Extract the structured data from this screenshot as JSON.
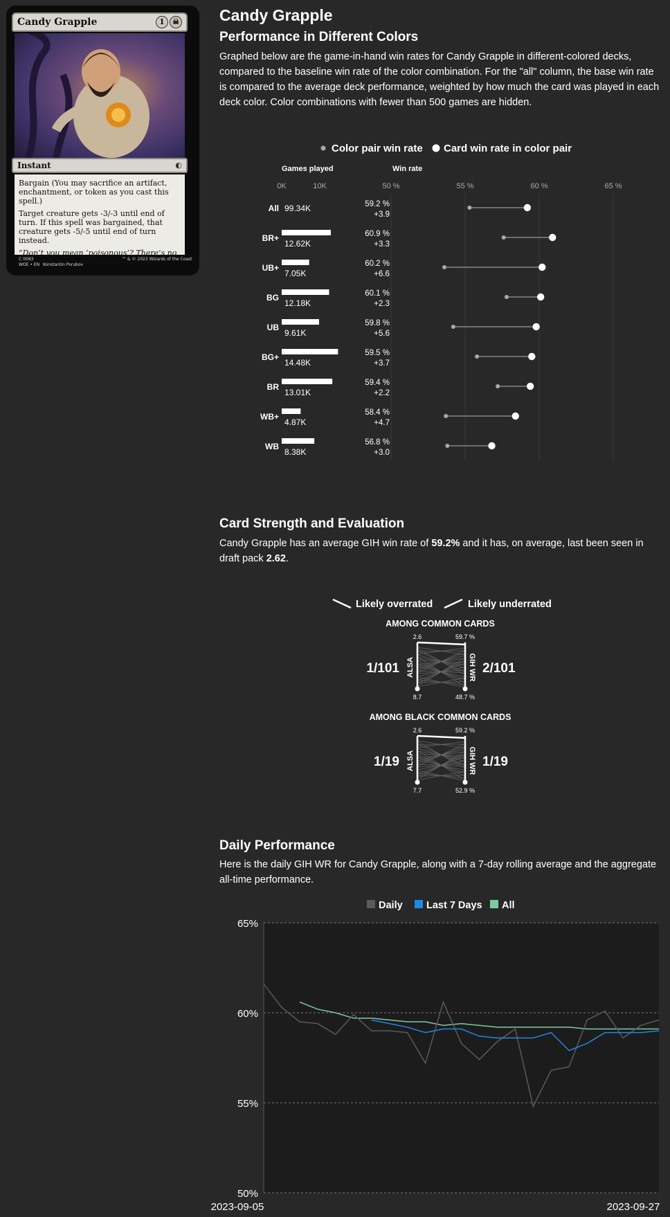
{
  "card": {
    "name": "Candy Grapple",
    "mana_cost": "1",
    "type_line": "Instant",
    "bargain_text": "Bargain (You may sacrifice an artifact, enchantment, or token as you cast this spell.)",
    "rules_text": "Target creature gets -3/-3 until end of turn. If this spell was bargained, that creature gets -5/-5 until end of turn instead.",
    "flavor_text": "“Don’t you mean ‘poisonous’? There’s no such thing as a venomous—AGGHHH!”",
    "collector": "C 0083",
    "set_lang": "WOE • EN",
    "artist": "Konstantin Porubov",
    "copyright": "™ & © 2023 Wizards of the Coast"
  },
  "page_title": "Candy Grapple",
  "colors_section": {
    "heading": "Performance in Different Colors",
    "description": "Graphed below are the game-in-hand win rates for Candy Grapple in different-colored decks, compared to the baseline win rate of the color combination. For the \"all\" column, the base win rate is compared to the average deck performance, weighted by how much the card was played in each deck color. Color combinations with fewer than 500 games are hidden."
  },
  "strength_section": {
    "heading": "Card Strength and Evaluation",
    "text_prefix": "Candy Grapple has an average GIH win rate of ",
    "gih_wr": "59.2%",
    "text_middle": " and it has, on average, last been seen in draft pack ",
    "alsa": "2.62",
    "text_suffix": ".",
    "legend_overrated": "Likely overrated",
    "legend_underrated": "Likely underrated"
  },
  "daily_section": {
    "heading": "Daily Performance",
    "description": "Here is the daily GIH WR for Candy Grapple, along with a 7-day rolling average and the aggregate all-time performance."
  },
  "chart_data": [
    {
      "type": "dumbbell",
      "legend": [
        "Color pair win rate",
        "Card win rate in color pair"
      ],
      "games_header": "Games played",
      "winrate_header": "Win rate",
      "games_ticks": [
        "0K",
        "10K"
      ],
      "games_max": 17000,
      "winrate_ticks": [
        50,
        55,
        60,
        65
      ],
      "xlim": [
        50,
        65
      ],
      "tick_suffix": " %",
      "rows": [
        {
          "label": "All",
          "games": 99340,
          "games_label": "99.34K",
          "card_wr": 59.2,
          "wr_label": "59.2 %",
          "diff_label": "+3.9",
          "base_wr": 55.3
        },
        {
          "label": "BR+",
          "games": 12620,
          "games_label": "12.62K",
          "card_wr": 60.9,
          "wr_label": "60.9 %",
          "diff_label": "+3.3",
          "base_wr": 57.6
        },
        {
          "label": "UB+",
          "games": 7050,
          "games_label": "7.05K",
          "card_wr": 60.2,
          "wr_label": "60.2 %",
          "diff_label": "+6.6",
          "base_wr": 53.6
        },
        {
          "label": "BG",
          "games": 12180,
          "games_label": "12.18K",
          "card_wr": 60.1,
          "wr_label": "60.1 %",
          "diff_label": "+2.3",
          "base_wr": 57.8
        },
        {
          "label": "UB",
          "games": 9610,
          "games_label": "9.61K",
          "card_wr": 59.8,
          "wr_label": "59.8 %",
          "diff_label": "+5.6",
          "base_wr": 54.2
        },
        {
          "label": "BG+",
          "games": 14480,
          "games_label": "14.48K",
          "card_wr": 59.5,
          "wr_label": "59.5 %",
          "diff_label": "+3.7",
          "base_wr": 55.8
        },
        {
          "label": "BR",
          "games": 13010,
          "games_label": "13.01K",
          "card_wr": 59.4,
          "wr_label": "59.4 %",
          "diff_label": "+2.2",
          "base_wr": 57.2
        },
        {
          "label": "WB+",
          "games": 4870,
          "games_label": "4.87K",
          "card_wr": 58.4,
          "wr_label": "58.4 %",
          "diff_label": "+4.7",
          "base_wr": 53.7
        },
        {
          "label": "WB",
          "games": 8380,
          "games_label": "8.38K",
          "card_wr": 56.8,
          "wr_label": "56.8 %",
          "diff_label": "+3.0",
          "base_wr": 53.8
        }
      ]
    },
    {
      "type": "slope",
      "title": "AMONG COMMON CARDS",
      "left_axis": "ALSA",
      "right_axis": "GIH WR",
      "alsa_top": "2.6",
      "alsa_bottom": "8.7",
      "wr_top": "59.7 %",
      "wr_bottom": "48.7 %",
      "alsa_rank": "1/101",
      "wr_rank": "2/101"
    },
    {
      "type": "slope",
      "title": "AMONG BLACK COMMON CARDS",
      "left_axis": "ALSA",
      "right_axis": "GIH WR",
      "alsa_top": "2.6",
      "alsa_bottom": "7.7",
      "wr_top": "59.2 %",
      "wr_bottom": "52.9 %",
      "alsa_rank": "1/19",
      "wr_rank": "1/19"
    },
    {
      "type": "line",
      "legend_position": "top-center",
      "ylim": [
        50,
        65
      ],
      "yticks": [
        50,
        55,
        60,
        65
      ],
      "ytick_labels": [
        "50%",
        "55%",
        "60%",
        "65%"
      ],
      "x_start_label": "2023-09-05",
      "x_end_label": "2023-09-27",
      "colors": {
        "Daily": "#5a5a5a",
        "Last 7 Days": "#1e88e5",
        "All": "#7ccba0"
      },
      "series": [
        {
          "name": "Daily",
          "values": [
            61.6,
            60.3,
            59.5,
            59.4,
            58.8,
            59.9,
            59.0,
            59.0,
            58.9,
            57.2,
            60.6,
            58.3,
            57.4,
            58.4,
            59.1,
            54.8,
            56.8,
            57.0,
            59.6,
            60.1,
            58.6,
            59.3,
            59.6
          ]
        },
        {
          "name": "Last 7 Days",
          "values": [
            null,
            null,
            null,
            null,
            null,
            null,
            59.6,
            59.4,
            59.2,
            58.9,
            59.1,
            59.1,
            58.7,
            58.6,
            58.6,
            58.6,
            58.9,
            57.9,
            58.3,
            58.9,
            58.9,
            58.9,
            59.0
          ]
        },
        {
          "name": "All",
          "values": [
            null,
            null,
            60.6,
            60.2,
            60.0,
            59.7,
            59.7,
            59.6,
            59.5,
            59.5,
            59.3,
            59.4,
            59.3,
            59.2,
            59.2,
            59.2,
            59.2,
            59.2,
            59.1,
            59.1,
            59.1,
            59.1,
            59.1
          ]
        }
      ]
    }
  ]
}
